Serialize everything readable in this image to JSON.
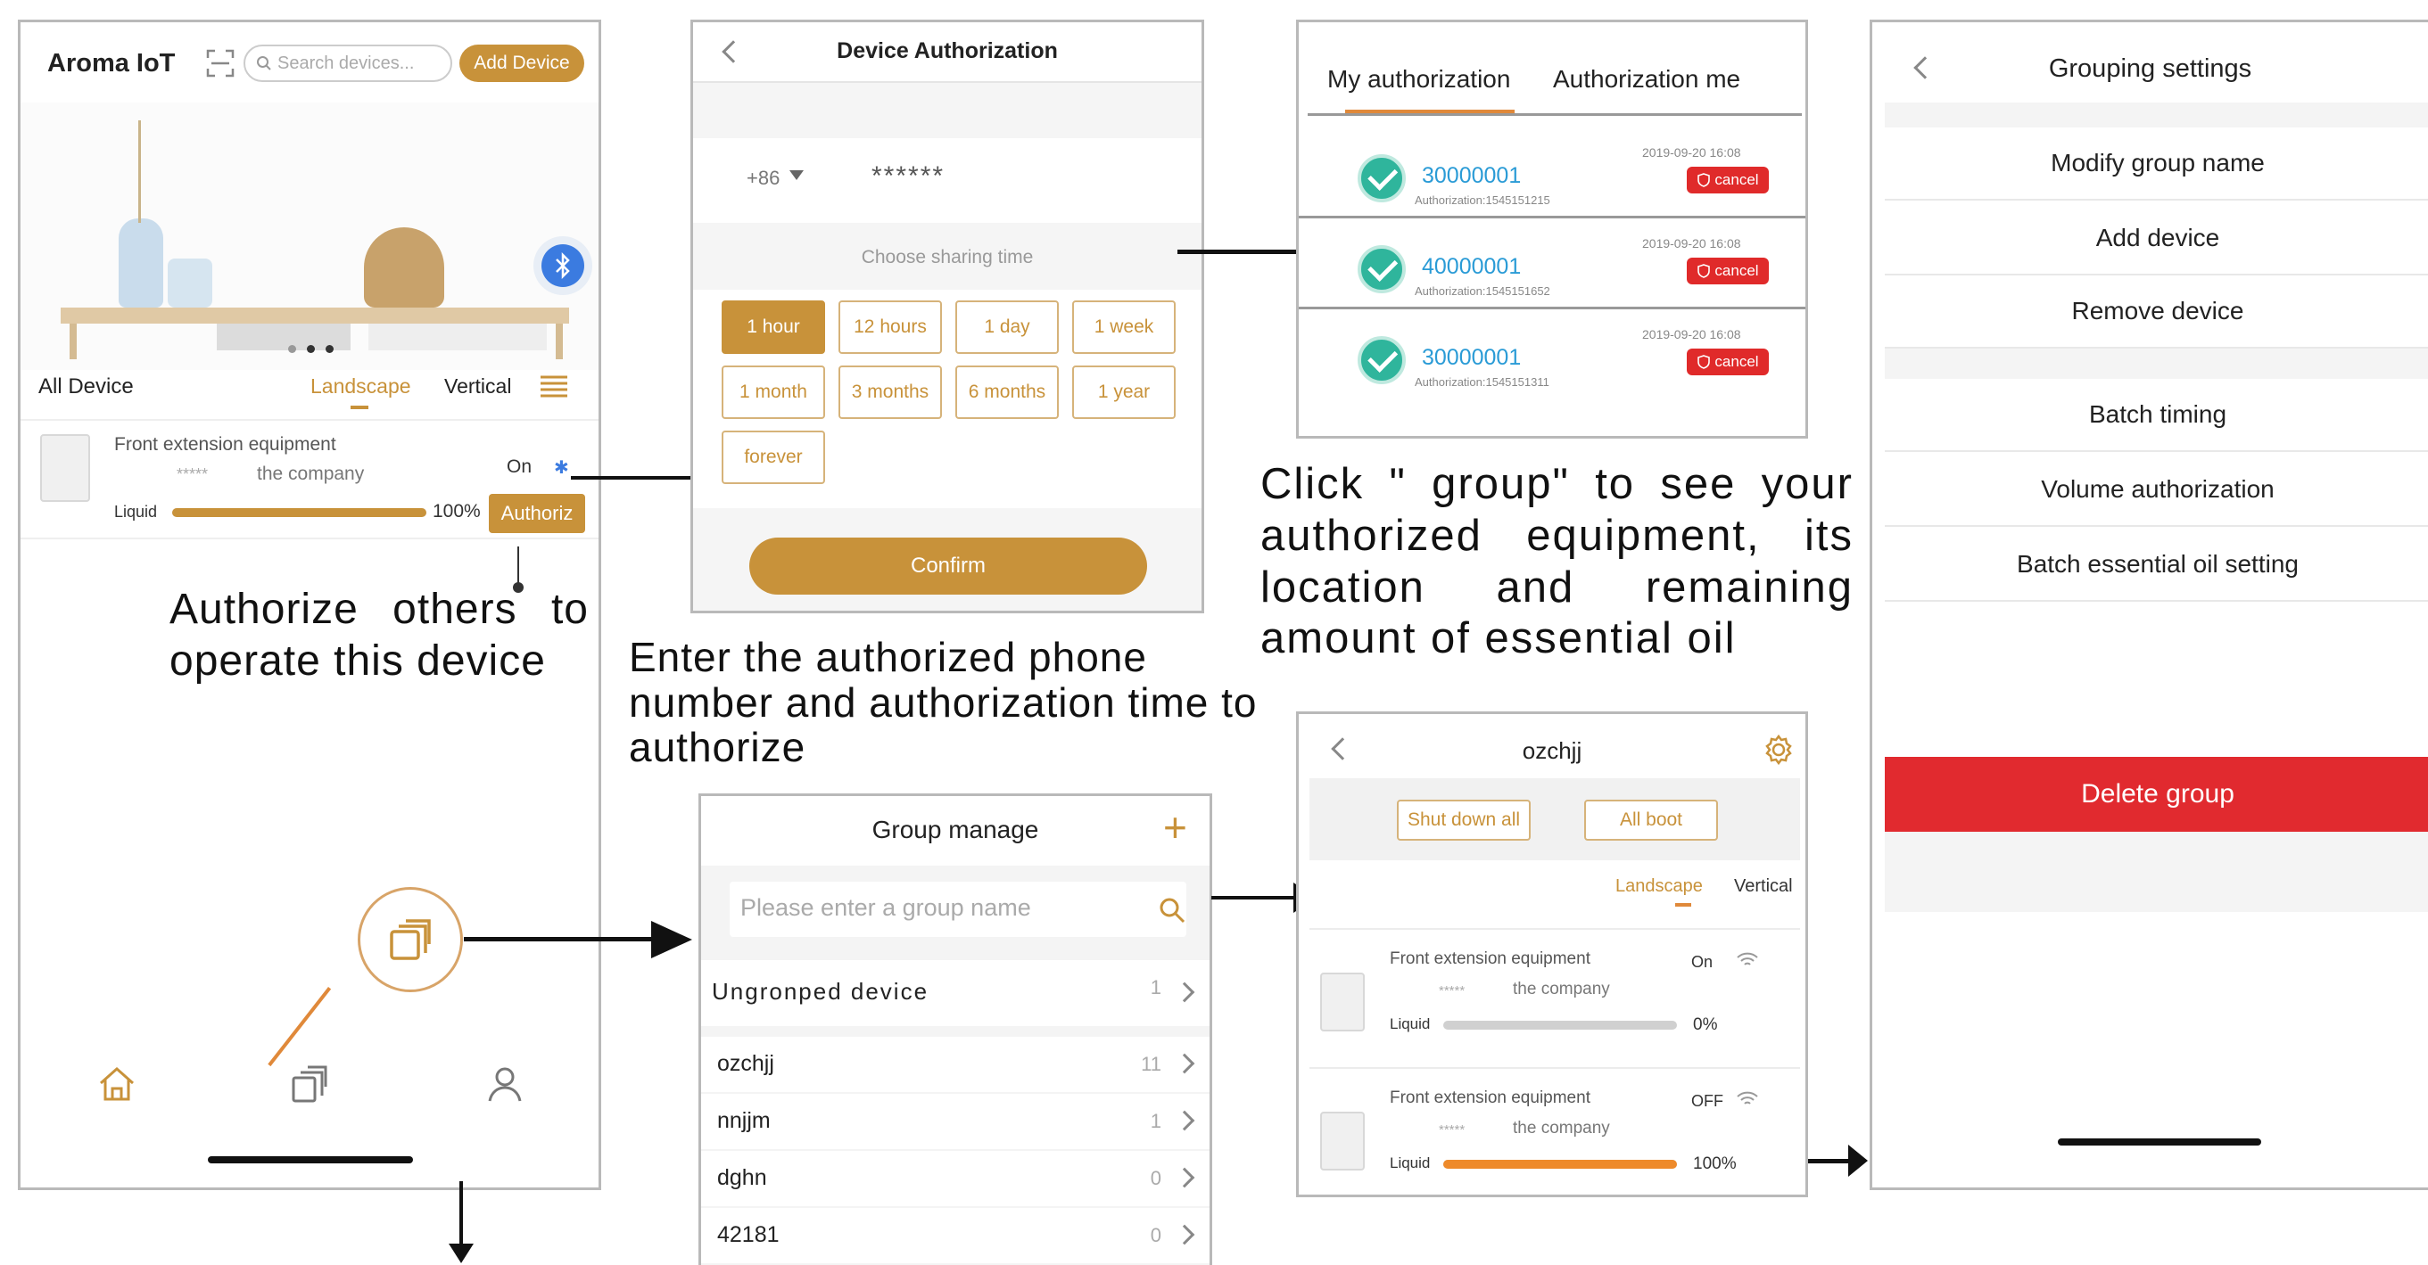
{
  "home": {
    "app_title": "Aroma IoT",
    "search_placeholder": "Search devices...",
    "add_device": "Add Device",
    "all_device": "All Device",
    "landscape": "Landscape",
    "vertical": "Vertical",
    "device": {
      "name": "Front extension equipment",
      "stars": "*****",
      "company": "the company",
      "status": "On",
      "liquid_label": "Liquid",
      "liquid_percent": "100%",
      "liquid_fraction": 1.0,
      "authorize_btn": "Authoriz"
    }
  },
  "annotations": {
    "authorize_others": "Authorize others to operate this device",
    "enter_phone": "Enter the authorized phone number and authorization time to authorize",
    "click_group": "Click \" group\" to see your authorized equipment, its location and remaining amount of essential oil"
  },
  "device_auth": {
    "title": "Device Authorization",
    "country_code": "+86",
    "phone_masked": "******",
    "choose_time": "Choose sharing time",
    "options": [
      "1 hour",
      "12 hours",
      "1 day",
      "1 week",
      "1 month",
      "3 months",
      "6 months",
      "1 year",
      "forever"
    ],
    "selected_index": 0,
    "confirm": "Confirm"
  },
  "my_auth": {
    "tab_mine": "My authorization",
    "tab_me": "Authorization me",
    "items": [
      {
        "id": "30000001",
        "sub": "Authorization:1545151215",
        "date": "2019-09-20  16:08",
        "cancel": "cancel"
      },
      {
        "id": "40000001",
        "sub": "Authorization:1545151652",
        "date": "2019-09-20  16:08",
        "cancel": "cancel"
      },
      {
        "id": "30000001",
        "sub": "Authorization:1545151311",
        "date": "2019-09-20  16:08",
        "cancel": "cancel"
      }
    ]
  },
  "grouping": {
    "title": "Grouping settings",
    "items": [
      "Modify group name",
      "Add device",
      "Remove device",
      "Batch timing",
      "Volume authorization",
      "Batch essential oil setting"
    ],
    "delete": "Delete group"
  },
  "group_manage": {
    "title": "Group manage",
    "plus": "+",
    "search_placeholder": "Please enter a group name",
    "rows": [
      {
        "name": "Ungronped device",
        "count": "1"
      },
      {
        "name": "ozchjj",
        "count": "11"
      },
      {
        "name": "nnjjm",
        "count": "1"
      },
      {
        "name": "dghn",
        "count": "0"
      },
      {
        "name": "42181",
        "count": "0"
      }
    ]
  },
  "group_detail": {
    "title": "ozchjj",
    "shut_down": "Shut down all",
    "all_boot": "All boot",
    "landscape": "Landscape",
    "vertical": "Vertical",
    "devices": [
      {
        "name": "Front extension equipment",
        "stars": "*****",
        "company": "the company",
        "status": "On",
        "liquid_label": "Liquid",
        "percent": "0%",
        "fraction": 0.0
      },
      {
        "name": "Front extension equipment",
        "stars": "*****",
        "company": "the company",
        "status": "OFF",
        "liquid_label": "Liquid",
        "percent": "100%",
        "fraction": 1.0
      }
    ]
  },
  "colors": {
    "accent": "#c8923a",
    "danger": "#e02a2a",
    "teal": "#2fb59c",
    "orange_bar": "#ee8a2a"
  },
  "icons": [
    "search-icon",
    "scan-icon",
    "bluetooth-icon",
    "menu-list-icon",
    "home-icon",
    "group-cards-icon",
    "user-icon",
    "gear-icon",
    "wifi-icon",
    "check-shield-icon",
    "chevron-right-icon",
    "back-chevron-icon"
  ]
}
